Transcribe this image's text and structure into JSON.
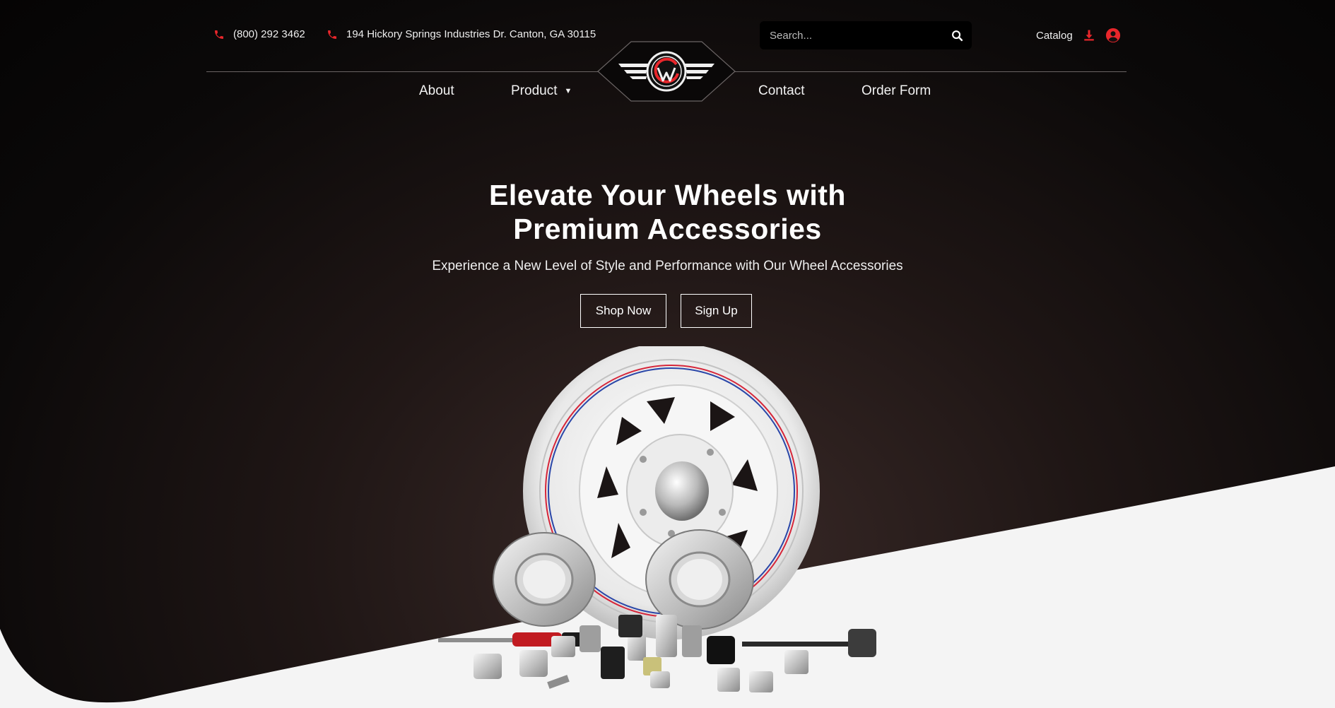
{
  "topbar": {
    "phone": "(800) 292 3462",
    "address": "194 Hickory Springs Industries Dr. Canton, GA 30115",
    "search_placeholder": "Search...",
    "catalog_label": "Catalog"
  },
  "nav": {
    "items": [
      {
        "label": "About"
      },
      {
        "label": "Product"
      },
      {
        "label": "Contact"
      },
      {
        "label": "Order Form"
      }
    ]
  },
  "hero": {
    "title_line1": "Elevate Your Wheels with",
    "title_line2": "Premium Accessories",
    "subtitle": "Experience a New Level of Style and Performance with Our Wheel Accessories",
    "shop_button": "Shop Now",
    "signup_button": "Sign Up"
  },
  "colors": {
    "accent": "#e8262b",
    "background_dark": "#0b0909",
    "curve_light": "#f4f4f4"
  },
  "icons": [
    "phone-icon",
    "search-icon",
    "download-icon",
    "user-icon",
    "chevron-down-icon",
    "logo"
  ]
}
